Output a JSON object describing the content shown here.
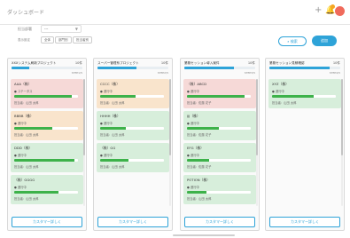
{
  "app": {
    "title": "ダッシュボード"
  },
  "header_icons": [
    "plus-icon",
    "bell-icon",
    "avatar"
  ],
  "filter": {
    "label": "担当部署",
    "select_value": "---",
    "settings_label": "表示設定",
    "chips": [
      "全体",
      "部門別",
      "担当者別"
    ]
  },
  "actions": {
    "search_label": "検索",
    "primary_label": "追加"
  },
  "colors": {
    "accent": "#2ea3d8",
    "green": "#d7eedb",
    "pink": "#f6d9d7",
    "orange": "#f9e4cc",
    "progress": "#3db24a"
  },
  "columns": [
    {
      "title": "XXXシステム刷新プロジェクト",
      "count": "10件",
      "progress": 0.25,
      "step": "STEP1/5",
      "footer": "カスタマー詳しく",
      "cards": [
        {
          "title": "AAA（株）",
          "status": "ステータス",
          "owner": "担当者：山田 太郎",
          "color": "pink",
          "progress": 0.9
        },
        {
          "title": "BBBB（株）",
          "status": "進行中",
          "owner": "担当者：山田 太郎",
          "color": "orange",
          "progress": 0.6
        },
        {
          "title": "DDD（株）",
          "status": "進行中",
          "owner": "担当者：山田 太郎",
          "color": "green",
          "progress": 0.95
        },
        {
          "title": "（株）GGGG",
          "status": "進行中",
          "owner": "担当者：山田 太郎",
          "color": "green",
          "progress": 0.7
        }
      ]
    },
    {
      "title": "スーパー管理系プロジェクト",
      "count": "10件",
      "progress": 0.55,
      "step": "STEP2/5",
      "footer": "カスタマー詳しく",
      "cards": [
        {
          "title": "CCCC（株）",
          "status": "進行中",
          "owner": "担当者：山田 太郎",
          "color": "orange",
          "progress": 0.55
        },
        {
          "title": "HHHH（株）",
          "status": "進行中",
          "owner": "担当者：山田 太郎",
          "color": "green",
          "progress": 0.4
        },
        {
          "title": "（株）GG",
          "status": "進行中",
          "owner": "担当者：山田 太郎",
          "color": "green",
          "progress": 0.45
        }
      ]
    },
    {
      "title": "業務セッション導入案件",
      "count": "10件",
      "progress": 0.7,
      "step": "STEP3/5",
      "footer": "カスタマー詳しく",
      "cards": [
        {
          "title": "（株）ABCD",
          "status": "進行中",
          "owner": "担当者：佐藤 花子",
          "color": "pink",
          "progress": 0.9
        },
        {
          "title": "JJJ（株）",
          "status": "進行中",
          "owner": "担当者：佐藤 花子",
          "color": "green",
          "progress": 0.5
        },
        {
          "title": "EFG（株）",
          "status": "進行中",
          "owner": "担当者：佐藤 花子",
          "color": "green",
          "progress": 0.35
        },
        {
          "title": "POTION（株）",
          "status": "進行中",
          "owner": "担当者：山田 太郎",
          "color": "green",
          "progress": 0.3
        }
      ]
    },
    {
      "title": "業務セッション見積確認",
      "count": "10件",
      "progress": 0.85,
      "step": "STEP4/5",
      "footer": "カスタマー詳しく",
      "cards": [
        {
          "title": "XYZ（株）",
          "status": "進行中",
          "owner": "担当者：山田 太郎",
          "color": "green",
          "progress": 0.65
        }
      ]
    }
  ]
}
